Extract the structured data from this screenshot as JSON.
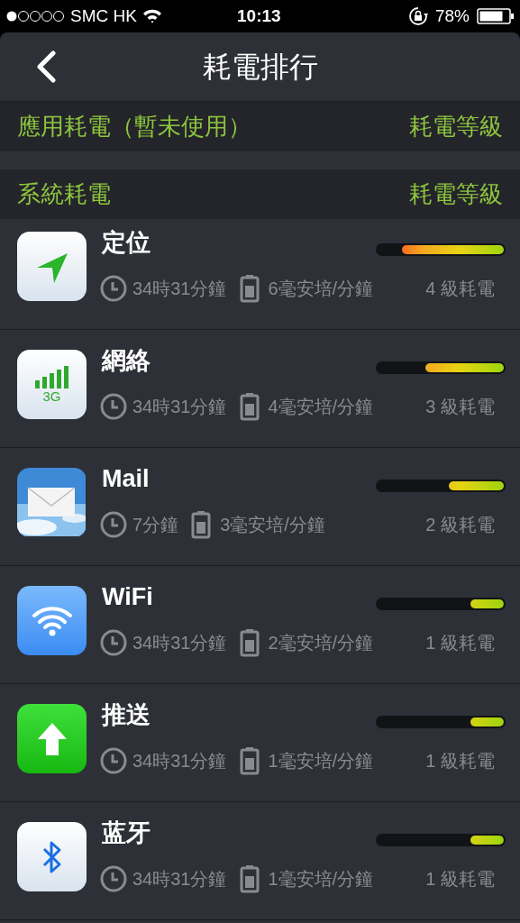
{
  "status_bar": {
    "carrier": "SMC HK",
    "time": "10:13",
    "battery": "78%"
  },
  "nav": {
    "title": "耗電排行"
  },
  "sections": [
    {
      "title": "應用耗電（暫未使用）",
      "right": "耗電等級"
    },
    {
      "title": "系統耗電",
      "right": "耗電等級"
    }
  ],
  "items": [
    {
      "kind": "location",
      "name": "定位",
      "time": "34時31分鐘",
      "current": "6毫安培/分鐘",
      "grade": "4 級耗電",
      "level": 0.8
    },
    {
      "kind": "network",
      "name": "網絡",
      "time": "34時31分鐘",
      "current": "4毫安培/分鐘",
      "grade": "3 級耗電",
      "level": 0.62,
      "icon_label": "3G"
    },
    {
      "kind": "mail",
      "name": "Mail",
      "time": "7分鐘",
      "current": "3毫安培/分鐘",
      "grade": "2 級耗電",
      "level": 0.44
    },
    {
      "kind": "wifi",
      "name": "WiFi",
      "time": "34時31分鐘",
      "current": "2毫安培/分鐘",
      "grade": "1 級耗電",
      "level": 0.27
    },
    {
      "kind": "push",
      "name": "推送",
      "time": "34時31分鐘",
      "current": "1毫安培/分鐘",
      "grade": "1 級耗電",
      "level": 0.27
    },
    {
      "kind": "bluetooth",
      "name": "蓝牙",
      "time": "34時31分鐘",
      "current": "1毫安培/分鐘",
      "grade": "1 級耗電",
      "level": 0.27
    }
  ]
}
